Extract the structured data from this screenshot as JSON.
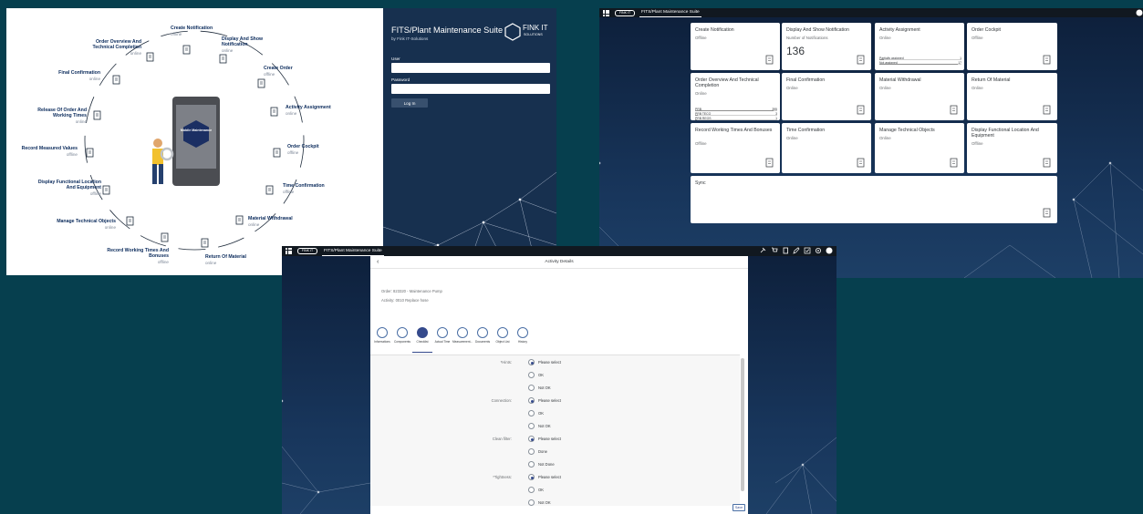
{
  "diagram": {
    "center_label": "Mobile Maintenance",
    "nodes": [
      {
        "name": "Create Notification",
        "status": "offline"
      },
      {
        "name": "Display And Show Notification",
        "status": "online"
      },
      {
        "name": "Create Order",
        "status": "offline"
      },
      {
        "name": "Activity Assignment",
        "status": "online"
      },
      {
        "name": "Order Cockpit",
        "status": "offline"
      },
      {
        "name": "Time Confirmation",
        "status": "offline"
      },
      {
        "name": "Material Withdrawal",
        "status": "online"
      },
      {
        "name": "Return Of Material",
        "status": "online"
      },
      {
        "name": "Record Working Times And Bonuses",
        "status": "offline"
      },
      {
        "name": "Manage Technical Objects",
        "status": "online"
      },
      {
        "name": "Display Functional Location And Equipment",
        "status": "offline"
      },
      {
        "name": "Record Measured Values",
        "status": "offline"
      },
      {
        "name": "Release Of Order And Working Times",
        "status": "online"
      },
      {
        "name": "Final Confirmation",
        "status": "online"
      },
      {
        "name": "Order Overview And Technical Completion",
        "status": "online"
      }
    ]
  },
  "login": {
    "title": "FITS/Plant Maintenance Suite",
    "subtitle": "by Fink IT-Solutions",
    "logo_text": "FINK IT",
    "logo_sub": "SOLUTIONS",
    "user_label": "User",
    "password_label": "Password",
    "login_button": "Log In"
  },
  "launchpad": {
    "shell_logo": "FINK IT",
    "shell_title": "FITS/Plant Maintenance Suite",
    "tiles": [
      {
        "title": "Create Notification",
        "sub": "Offline",
        "icon": "create-notification-icon"
      },
      {
        "title": "Display And Show Notification",
        "sub": "Number of Notifications",
        "value": "136",
        "icon": "edit-notification-icon"
      },
      {
        "title": "Activity Assignment",
        "sub": "Online",
        "bars": [
          {
            "label": "Partially assigned",
            "value": "1",
            "fill": 0.05
          },
          {
            "label": "Not assigned",
            "value": "17",
            "fill": 0.95
          }
        ]
      },
      {
        "title": "Order Cockpit",
        "sub": "Offline",
        "icon": "order-cockpit-icon"
      },
      {
        "title": "Order Overview And Technical Completion",
        "sub": "Online",
        "bars": [
          {
            "label": "PRB",
            "value": "395",
            "fill": 0.95
          },
          {
            "label": "PRB TECO",
            "value": "3",
            "fill": 0.03
          },
          {
            "label": "PRB REOS",
            "value": "1",
            "fill": 0.02
          }
        ]
      },
      {
        "title": "Final Confirmation",
        "sub": "Online",
        "icon": "final-confirmation-icon"
      },
      {
        "title": "Material Withdrawal",
        "sub": "Online",
        "icon": "material-withdrawal-icon"
      },
      {
        "title": "Return Of Material",
        "sub": "Online",
        "icon": "return-material-icon"
      },
      {
        "title": "Record Working Times And Bonuses",
        "sub": "Offline",
        "icon": "working-times-icon"
      },
      {
        "title": "Time Confirmation",
        "sub": "Online",
        "icon": "time-confirmation-icon"
      },
      {
        "title": "Manage Technical Objects",
        "sub": "Online",
        "icon": "technical-objects-icon"
      },
      {
        "title": "Display Functional Location And Equipment",
        "sub": "Offline",
        "icon": "functional-location-icon"
      },
      {
        "title": "Sync",
        "sub": "",
        "icon": "sync-icon"
      }
    ]
  },
  "activity": {
    "shell_logo": "FINK IT",
    "shell_title": "FITS/Plant Maintenance Suite",
    "header_title": "Activity Details",
    "order_line": "Order: 823320 - Maintenance Pump",
    "activity_line": "Activity: 0010 Replace hose",
    "tabs": [
      "Informations",
      "Components",
      "Checklist",
      "Actual Time",
      "Measurement...",
      "Documents",
      "Object List",
      "History"
    ],
    "selected_tab": 2,
    "questions": [
      {
        "label": "*Hints:",
        "options": [
          "Please select",
          "OK",
          "Not OK"
        ],
        "selected": 0
      },
      {
        "label": "Connection:",
        "options": [
          "Please select",
          "OK",
          "Not OK"
        ],
        "selected": 0
      },
      {
        "label": "Clean filter:",
        "options": [
          "Please select",
          "Done",
          "Not Done"
        ],
        "selected": 0
      },
      {
        "label": "*Tightness:",
        "options": [
          "Please select",
          "OK",
          "Not OK"
        ],
        "selected": 0
      }
    ],
    "save_button": "Save"
  }
}
